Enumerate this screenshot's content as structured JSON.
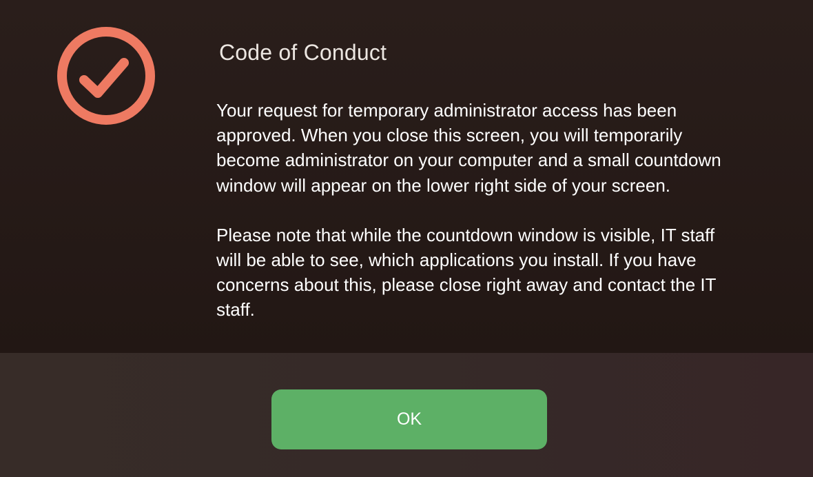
{
  "dialog": {
    "title": "Code of Conduct",
    "status_icon": "check-circle-icon",
    "paragraphs": [
      "Your request for temporary administrator access has been\napproved. When you close this screen, you will temporarily\nbecome administrator on your computer and a small countdown\nwindow will appear on the lower right side of your screen.",
      "Please note that while the countdown window is visible, IT staff\nwill be able to see, which applications you install. If you have\nconcerns about this, please close right away and contact the IT\nstaff."
    ],
    "ok_label": "OK"
  },
  "colors": {
    "accent_icon": "#ee7a62",
    "ok_button": "#5db066",
    "background_top": "#241917",
    "background_bottom": "#362a28"
  }
}
